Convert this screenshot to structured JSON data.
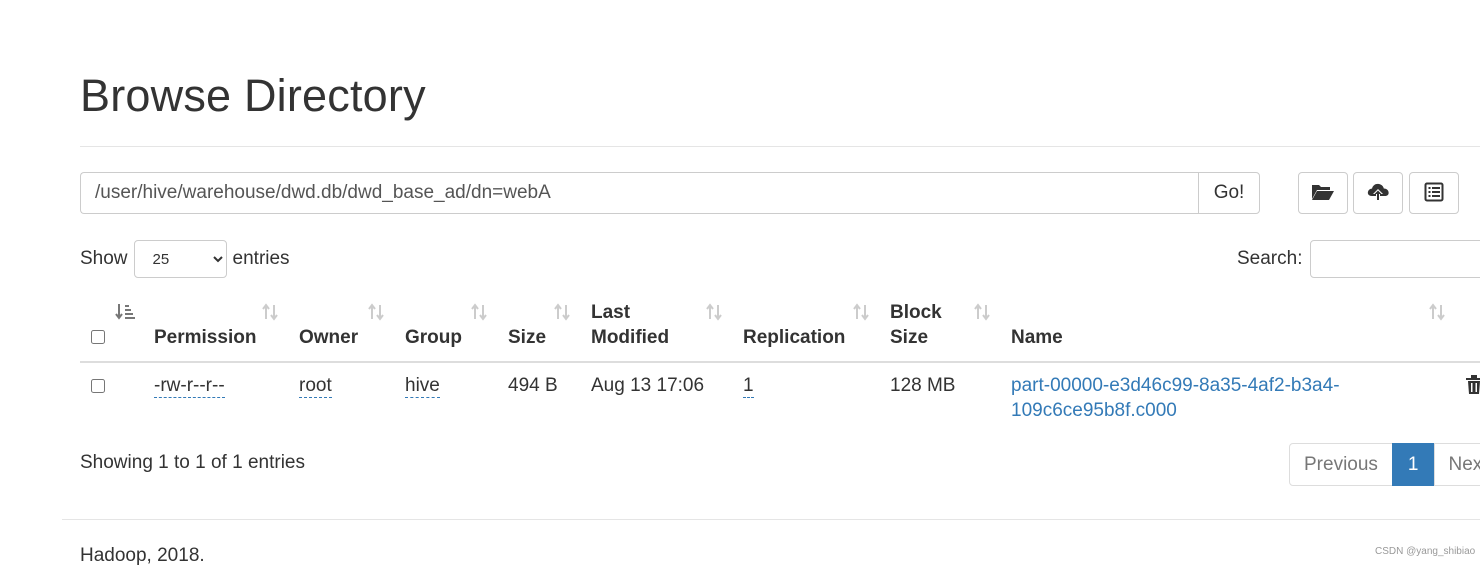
{
  "page": {
    "title": "Browse Directory",
    "footer": "Hadoop, 2018.",
    "watermark": "CSDN @yang_shibiao"
  },
  "path_bar": {
    "value": "/user/hive/warehouse/dwd.db/dwd_base_ad/dn=webA",
    "go_label": "Go!"
  },
  "toolbar": {
    "icons": [
      "folder-open-icon",
      "cloud-upload-icon",
      "list-alt-icon"
    ]
  },
  "length_menu": {
    "prefix": "Show",
    "selected": "25",
    "suffix": "entries"
  },
  "search": {
    "label": "Search:",
    "value": ""
  },
  "table": {
    "columns": {
      "permission": "Permission",
      "owner": "Owner",
      "group": "Group",
      "size": "Size",
      "last_modified_1": "Last",
      "last_modified_2": "Modified",
      "replication": "Replication",
      "block_size_1": "Block",
      "block_size_2": "Size",
      "name": "Name"
    },
    "rows": [
      {
        "permission": "-rw-r--r--",
        "owner": "root",
        "group": "hive",
        "size": "494 B",
        "last_modified": "Aug 13 17:06",
        "replication": "1",
        "block_size": "128 MB",
        "name_line1": "part-00000-e3d46c99-8a35-4af2-b3a4-",
        "name_line2": "109c6ce95b8f.c000"
      }
    ]
  },
  "table_info": "Showing 1 to 1 of 1 entries",
  "pagination": {
    "previous": "Previous",
    "current": "1",
    "next": "Next",
    "accent_color": "#337ab7"
  }
}
